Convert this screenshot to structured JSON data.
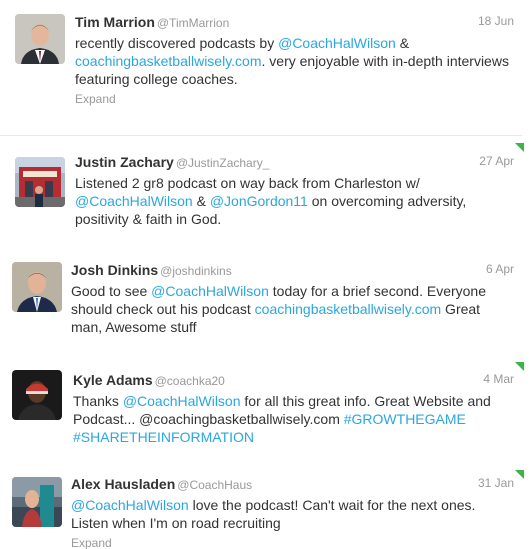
{
  "tweets": [
    {
      "name": "Tim Marrion",
      "handle": "@TimMarrion",
      "time": "18 Jun",
      "text": {
        "t1": "recently discovered podcasts by ",
        "l1": "@CoachHalWilson",
        "t2": " & ",
        "l2": "coachingbasketballwisely.com",
        "t3": ". very enjoyable with in-depth interviews featuring college coaches."
      },
      "expand": "Expand"
    },
    {
      "name": "Justin Zachary",
      "handle": "@JustinZachary_",
      "time": "27 Apr",
      "text": {
        "t1": "Listened 2 gr8 podcast on way back from Charleston w/ ",
        "l1": "@CoachHalWilson",
        "t2": " & ",
        "l2": "@JonGordon11",
        "t3": " on overcoming adversity, positivity & faith in God."
      }
    },
    {
      "name": "Josh Dinkins",
      "handle": "@joshdinkins",
      "time": "6 Apr",
      "text": {
        "t1": "Good to see ",
        "l1": "@CoachHalWilson",
        "t2": " today for a brief second. Everyone should check out his podcast ",
        "l2": "coachingbasketballwisely.com",
        "t3": " Great man, Awesome stuff"
      }
    },
    {
      "name": "Kyle Adams",
      "handle": "@coachka20",
      "time": "4 Mar",
      "text": {
        "t1": "Thanks ",
        "l1": "@CoachHalWilson",
        "t2": " for all this great info. Great Website and Podcast... @coachingbasketballwisely.com ",
        "l2": "#GROWTHEGAME",
        "t3": " ",
        "l3": "#SHARETHEINFORMATION"
      }
    },
    {
      "name": "Alex Hausladen",
      "handle": "@CoachHaus",
      "time": "31 Jan",
      "text": {
        "l1": "@CoachHalWilson",
        "t1": " love the podcast! Can't wait for the next ones. Listen when I'm on road recruiting"
      },
      "expand": "Expand"
    }
  ],
  "colors": {
    "link": "#2aa7e0",
    "muted": "#999999",
    "text": "#333333",
    "new_marker": "#3bb54a"
  }
}
